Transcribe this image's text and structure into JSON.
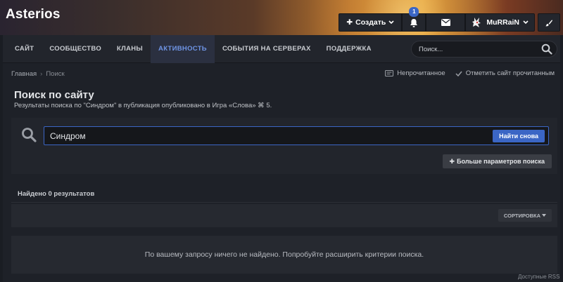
{
  "site": {
    "title": "Asterios"
  },
  "topbar": {
    "create_label": "Создать",
    "notifications_count": "1",
    "username": "MuRRaiN"
  },
  "nav": {
    "items": [
      {
        "label": "САЙТ"
      },
      {
        "label": "СООБЩЕСТВО"
      },
      {
        "label": "КЛАНЫ"
      },
      {
        "label": "АКТИВНОСТЬ"
      },
      {
        "label": "СОБЫТИЯ НА СЕРВЕРАХ"
      },
      {
        "label": "ПОДДЕРЖКА"
      }
    ],
    "active": "АКТИВНОСТЬ",
    "search_placeholder": "Поиск..."
  },
  "breadcrumb": {
    "home": "Главная",
    "separator": "›",
    "current": "Поиск"
  },
  "crumb_actions": {
    "unread": "Непрочитанное",
    "mark_read": "Отметить сайт прочитанным"
  },
  "page": {
    "title": "Поиск по сайту",
    "subtitle": "Результаты поиска по \"Синдром\" в публикация опубликовано в Игра «Слова» ⌘ 5."
  },
  "search": {
    "value": "Синдром",
    "submit_label": "Найти снова",
    "more_label": "Больше параметров поиска"
  },
  "results": {
    "heading": "Найдено 0 результатов",
    "sort_label": "СОРТИРОВКА",
    "empty_message": "По вашему запросу ничего не найдено. Попробуйте расширить критерии поиска."
  },
  "footer": {
    "rss": "Доступные RSS-лен"
  },
  "colors": {
    "accent": "#3b66c5",
    "nav_active": "#6f95e6"
  }
}
